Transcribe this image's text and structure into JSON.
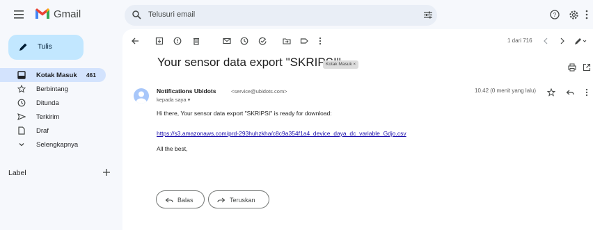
{
  "app": {
    "name": "Gmail"
  },
  "search": {
    "placeholder": "Telusuri email"
  },
  "compose": {
    "label": "Tulis"
  },
  "sidebar": {
    "items": [
      {
        "label": "Kotak Masuk",
        "count": "461",
        "icon": "inbox-icon"
      },
      {
        "label": "Berbintang",
        "icon": "star-icon"
      },
      {
        "label": "Ditunda",
        "icon": "clock-icon"
      },
      {
        "label": "Terkirim",
        "icon": "send-icon"
      },
      {
        "label": "Draf",
        "icon": "draft-icon"
      },
      {
        "label": "Selengkapnya",
        "icon": "chevron-down-icon"
      }
    ],
    "labels_heading": "Label"
  },
  "toolbar": {
    "pagination": "1 dari 716"
  },
  "message": {
    "subject": "Your sensor data export \"SKRIPSI\"",
    "label_chip": "Kotak Masuk ×",
    "sender_name": "Notifications Ubidots",
    "sender_email": "<service@ubidots.com>",
    "to": "kepada saya ▾",
    "time": "10.42 (0 menit yang lalu)",
    "body_line1": "Hi there, Your sensor data export \"SKRIPSI\" is ready for download:",
    "link": "https://s3.amazonaws.com/prd-293huhzkha/c8c9a354f1a4_device_daya_dc_variable_Gdjo.csv",
    "body_line2": "All the best,"
  },
  "actions": {
    "reply": "Balas",
    "forward": "Teruskan"
  },
  "colors": {
    "compose_bg": "#c2e7ff",
    "active_nav_bg": "#d3e3fd",
    "search_bg": "#e9eef6",
    "app_bg": "#f6f8fc",
    "link": "#1a0dab"
  }
}
